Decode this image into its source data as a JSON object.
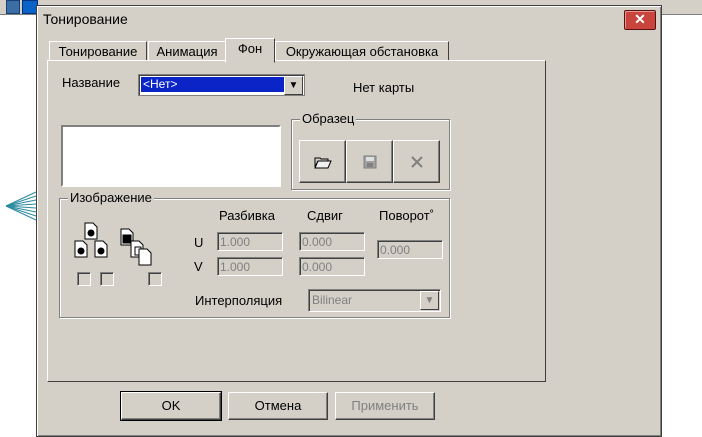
{
  "dialog": {
    "title": "Тонирование",
    "close_symbol": "✕"
  },
  "tabs": [
    {
      "label": "Тонирование",
      "active": false
    },
    {
      "label": "Анимация",
      "active": false
    },
    {
      "label": "Фон",
      "active": true
    },
    {
      "label": "Окружающая обстановка",
      "active": false
    }
  ],
  "name_row": {
    "label": "Название",
    "value": "<Нет>",
    "status": "Нет карты"
  },
  "sample_group": {
    "title": "Образец",
    "buttons": [
      {
        "icon": "open-folder-icon",
        "glyph": "📂"
      },
      {
        "icon": "save-icon",
        "glyph": "💾"
      },
      {
        "icon": "delete-icon",
        "glyph": "✕"
      }
    ]
  },
  "image_group": {
    "title": "Изображение",
    "col_tiling": "Разбивка",
    "col_offset": "Сдвиг",
    "col_rotation": "Поворот˚",
    "row_u": "U",
    "row_v": "V",
    "u_tiling": "1.000",
    "u_offset": "0.000",
    "v_tiling": "1.000",
    "v_offset": "0.000",
    "rotation": "0.000",
    "interpolation_label": "Интерполяция",
    "interpolation_value": "Bilinear"
  },
  "footer": {
    "ok": "OK",
    "cancel": "Отмена",
    "apply": "Применить"
  }
}
